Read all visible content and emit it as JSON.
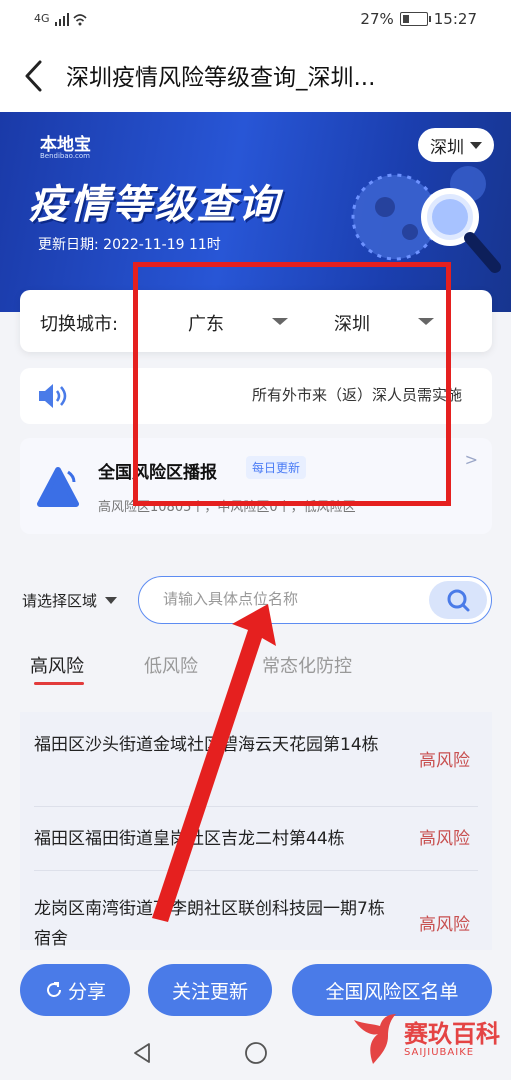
{
  "status": {
    "network": "4G",
    "battery": "27%",
    "time": "15:27"
  },
  "header": {
    "title": "深圳疫情风险等级查询_深圳..."
  },
  "banner": {
    "brand": "本地宝",
    "brand_sub": "Bendibao.com",
    "city": "深圳",
    "title": "疫情等级查询",
    "update_label": "更新日期: 2022-11-19 11时"
  },
  "city_switch": {
    "label": "切换城市:",
    "province": "广东",
    "city": "深圳"
  },
  "notice": {
    "text": "所有外市来（返）深人员需实施"
  },
  "broadcast": {
    "title": "全国风险区播报",
    "badge": "每日更新",
    "subtitle": "高风险区10805个，中风险区0个，低风险区"
  },
  "search": {
    "region_label": "请选择区域",
    "placeholder": "请输入具体点位名称"
  },
  "tabs": [
    "高风险",
    "低风险",
    "常态化防控"
  ],
  "list": [
    {
      "text": "福田区沙头街道金域社区碧海云天花园第14栋",
      "risk": "高风险"
    },
    {
      "text": "福田区福田街道皇岗社区吉龙二村第44栋",
      "risk": "高风险"
    },
    {
      "text": "龙岗区南湾街道下李朗社区联创科技园一期7栋宿舍",
      "risk": "高风险"
    }
  ],
  "actions": {
    "share": "分享",
    "follow": "关注更新",
    "national": "全国风险区名单"
  },
  "watermark": {
    "title": "赛玖百科",
    "sub": "SAIJIUBAIKE"
  },
  "colors": {
    "accent": "#4a7be8",
    "risk": "#c85050",
    "annotation": "#e5201f"
  }
}
